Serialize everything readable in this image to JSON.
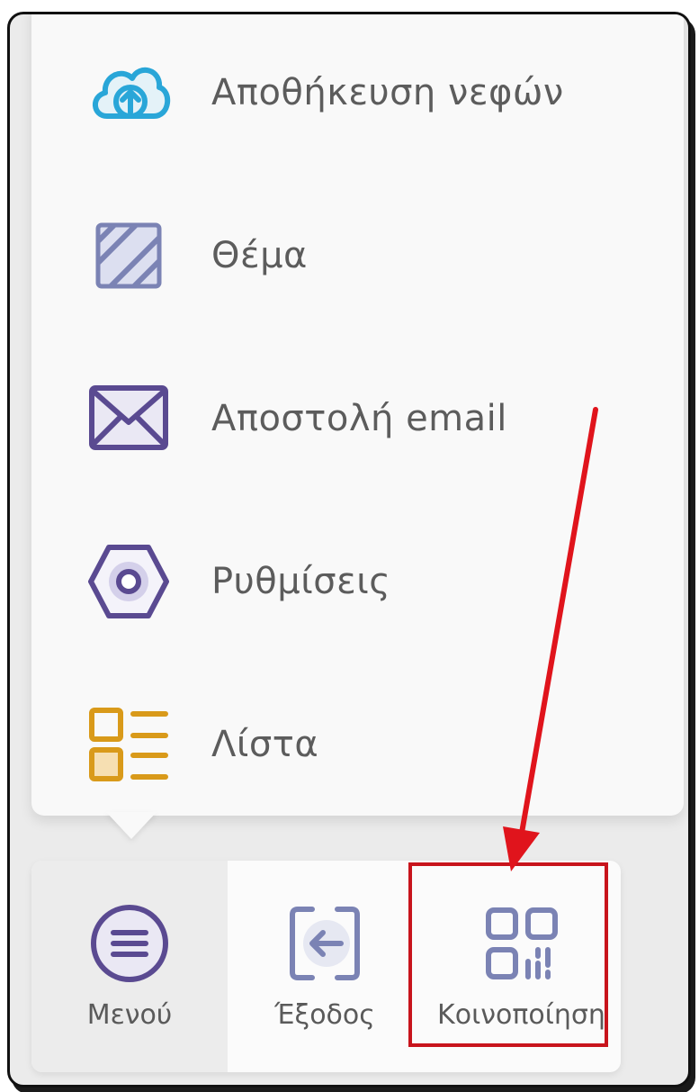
{
  "menu": {
    "items": [
      {
        "label": "Αποθήκευση νεφών",
        "icon": "cloud-upload-icon"
      },
      {
        "label": "Θέμα",
        "icon": "theme-hatch-icon"
      },
      {
        "label": "Αποστολή email",
        "icon": "envelope-icon"
      },
      {
        "label": "Ρυθμίσεις",
        "icon": "hexagon-settings-icon"
      },
      {
        "label": "Λίστα",
        "icon": "list-icon"
      }
    ]
  },
  "bottom_bar": {
    "tabs": [
      {
        "label": "Μενού",
        "icon": "menu-lines-icon",
        "active": true
      },
      {
        "label": "Έξοδος",
        "icon": "exit-arrow-icon",
        "active": false
      },
      {
        "label": "Κοινοποίηση",
        "icon": "qr-code-icon",
        "active": false
      }
    ]
  },
  "colors": {
    "cloud": "#29a6d8",
    "theme": "#7b83b4",
    "envelope": "#5a4a91",
    "settings": "#5a4a91",
    "list": "#d99a1a",
    "annotation": "#e0141c"
  }
}
